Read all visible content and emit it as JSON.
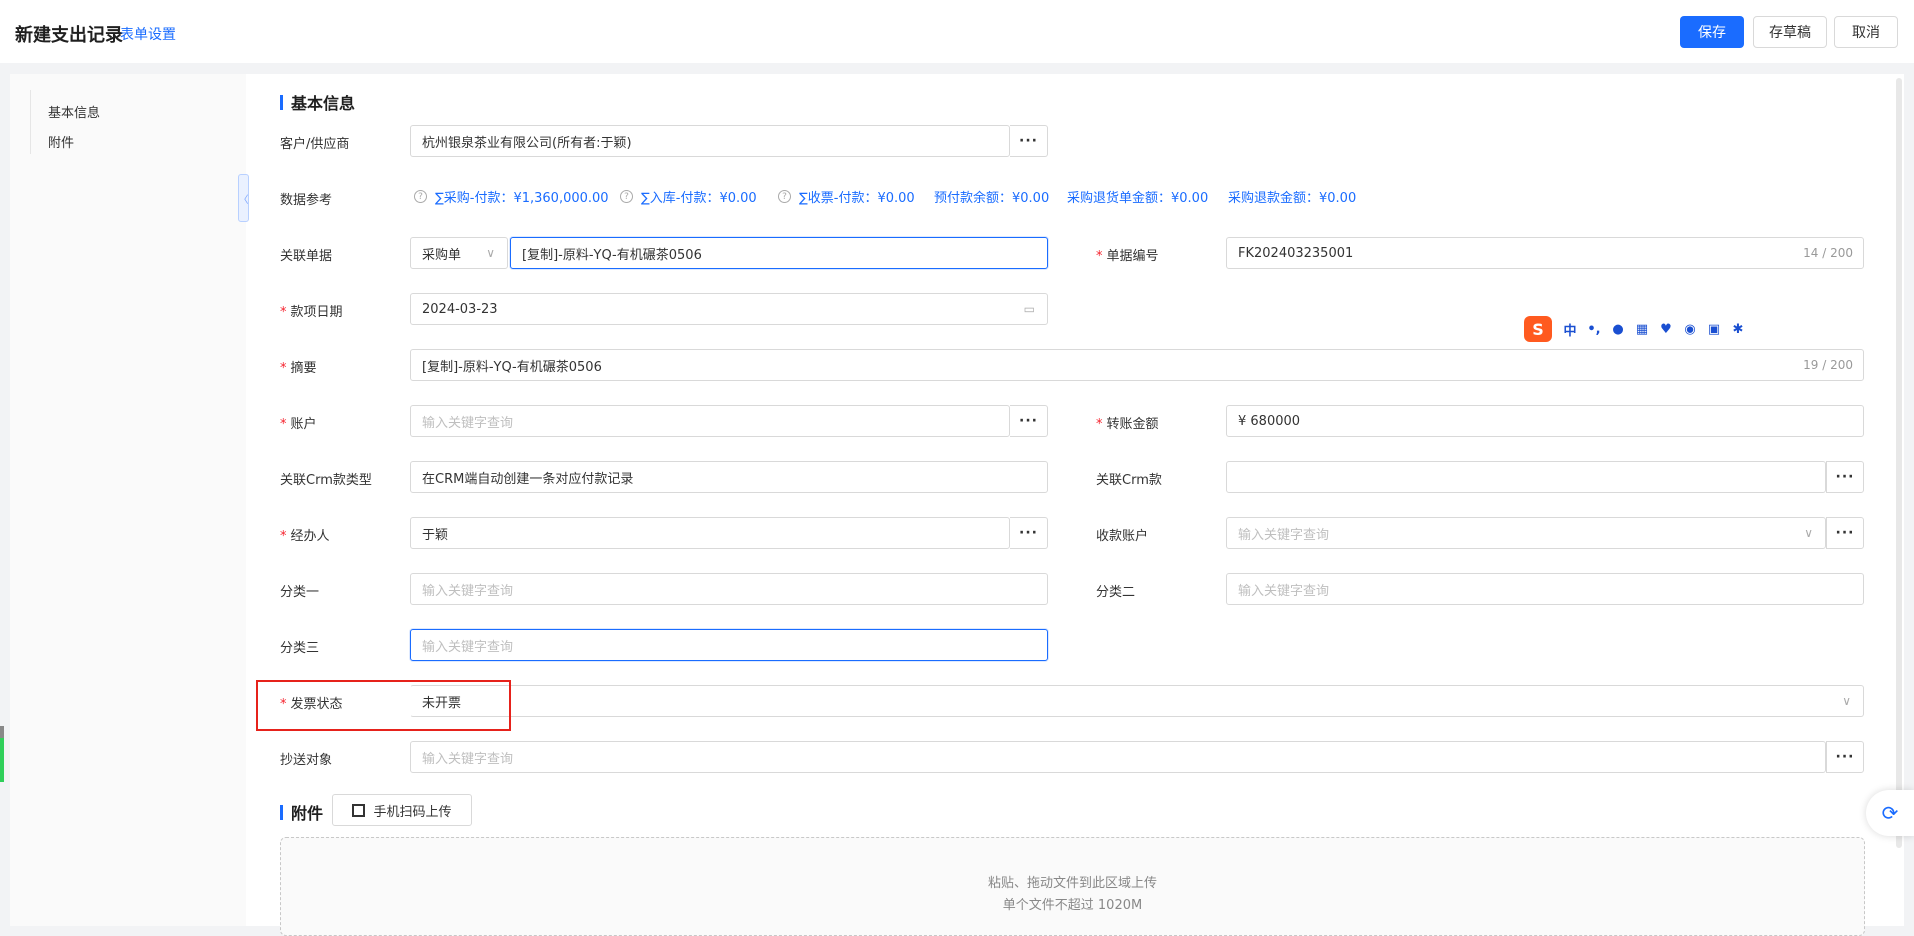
{
  "header": {
    "title": "新建支出记录",
    "form_settings": "表单设置",
    "save": "保存",
    "draft": "存草稿",
    "cancel": "取消"
  },
  "nav": {
    "items": [
      "基本信息",
      "附件"
    ]
  },
  "sections": {
    "basic": "基本信息",
    "attachment": "附件"
  },
  "form": {
    "customer": {
      "label": "客户/供应商",
      "value": "杭州银泉茶业有限公司(所有者:于颖)"
    },
    "data_ref": {
      "label": "数据参考",
      "items": [
        "∑采购-付款：¥1,360,000.00",
        "∑入库-付款：¥0.00",
        "∑收票-付款：¥0.00",
        "预付款余额：¥0.00",
        "采购退货单金额：¥0.00",
        "采购退款金额：¥0.00"
      ]
    },
    "linked_doc": {
      "label": "关联单据",
      "type": "采购单",
      "value": "[复制]-原料-YQ-有机碾茶0506"
    },
    "doc_number": {
      "label": "单据编号",
      "value": "FK202403235001",
      "counter": "14 / 200"
    },
    "date": {
      "label": "款项日期",
      "value": "2024-03-23"
    },
    "summary": {
      "label": "摘要",
      "value": "[复制]-原料-YQ-有机碾茶0506",
      "counter": "19 / 200"
    },
    "account": {
      "label": "账户",
      "placeholder": "输入关键字查询"
    },
    "amount": {
      "label": "转账金额",
      "value": "¥ 680000"
    },
    "crm_type": {
      "label": "关联Crm款类型",
      "value": "在CRM端自动创建一条对应付款记录"
    },
    "crm": {
      "label": "关联Crm款",
      "value": ""
    },
    "handler": {
      "label": "经办人",
      "value": "于颖"
    },
    "receive_account": {
      "label": "收款账户",
      "placeholder": "输入关键字查询"
    },
    "cat1": {
      "label": "分类一",
      "placeholder": "输入关键字查询"
    },
    "cat2": {
      "label": "分类二",
      "placeholder": "输入关键字查询"
    },
    "cat3": {
      "label": "分类三",
      "placeholder": "输入关键字查询"
    },
    "invoice_status": {
      "label": "发票状态",
      "value": "未开票"
    },
    "cc": {
      "label": "抄送对象",
      "placeholder": "输入关键字查询"
    }
  },
  "attachment": {
    "upload_button": "手机扫码上传",
    "drop_hint": "粘贴、拖动文件到此区域上传",
    "size_hint": "单个文件不超过 1020M"
  },
  "ime": {
    "logo": "S",
    "mode": "中",
    "punct": "•,"
  },
  "colors": {
    "accent": "#1a6cff",
    "required": "#f5222d",
    "highlight": "#e6221b"
  }
}
